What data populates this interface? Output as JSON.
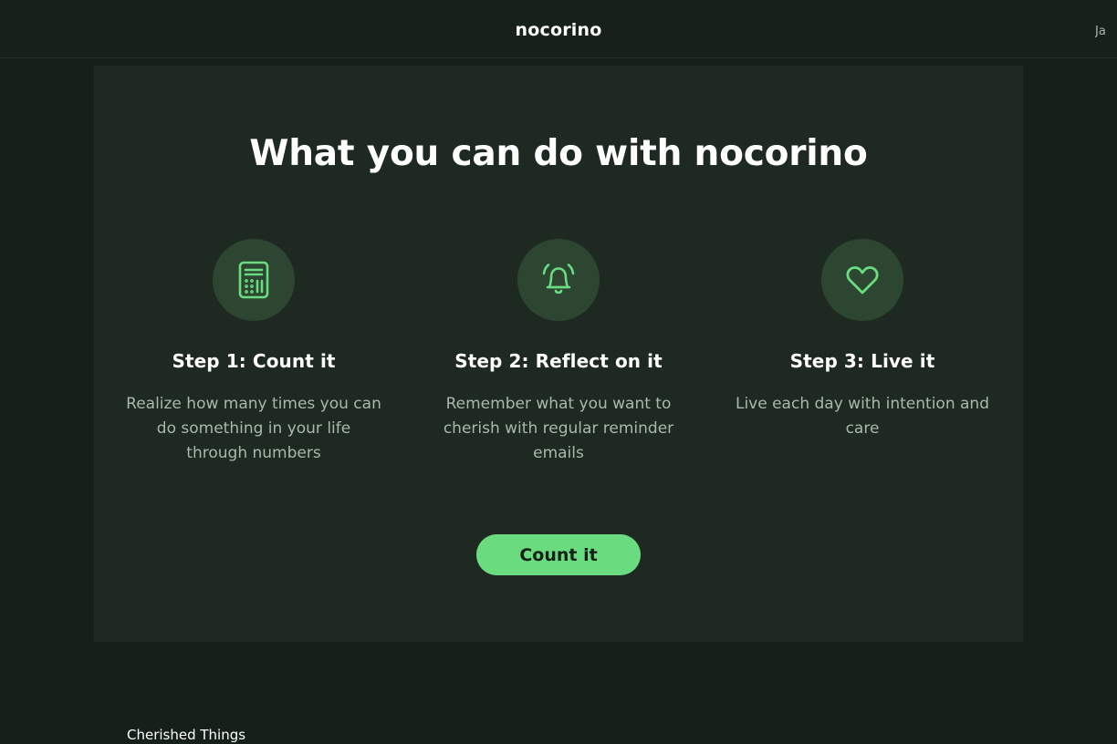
{
  "header": {
    "brand": "nocorino",
    "language_label": "Ja"
  },
  "main": {
    "headline": "What you can do with nocorino",
    "steps": [
      {
        "icon": "calculator-icon",
        "title": "Step 1: Count it",
        "description": "Realize how many times you can do something in your life through numbers"
      },
      {
        "icon": "bell-icon",
        "title": "Step 2: Reflect on it",
        "description": "Remember what you want to cherish with regular reminder emails"
      },
      {
        "icon": "heart-icon",
        "title": "Step 3: Live it",
        "description": "Live each day with intention and care"
      }
    ],
    "cta_label": "Count it"
  },
  "footer": {
    "link": "Cherished Things"
  },
  "colors": {
    "accent": "#6adc7f",
    "background": "#16201a",
    "card": "#1e2a21",
    "icon_circle": "#2c4632"
  }
}
